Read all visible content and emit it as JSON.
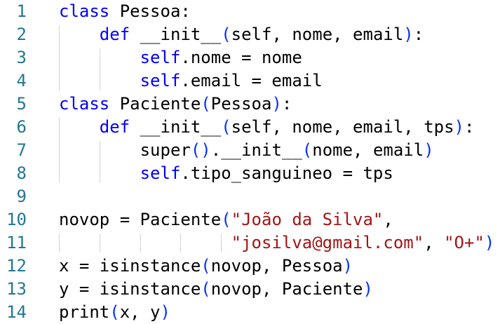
{
  "editor": {
    "lines": [
      {
        "n": "1",
        "t": [
          {
            "c": "kw",
            "v": "class"
          },
          {
            "c": "",
            "v": " Pessoa:"
          }
        ]
      },
      {
        "n": "2",
        "t": [
          {
            "c": "",
            "v": "    "
          },
          {
            "c": "kw",
            "v": "def"
          },
          {
            "c": "",
            "v": " __init__"
          },
          {
            "c": "br",
            "v": "("
          },
          {
            "c": "",
            "v": "self, nome, email"
          },
          {
            "c": "br",
            "v": ")"
          },
          {
            "c": "",
            "v": ":"
          }
        ]
      },
      {
        "n": "3",
        "t": [
          {
            "c": "",
            "v": "        "
          },
          {
            "c": "sf",
            "v": "self"
          },
          {
            "c": "",
            "v": ".nome = nome"
          }
        ]
      },
      {
        "n": "4",
        "t": [
          {
            "c": "",
            "v": "        "
          },
          {
            "c": "sf",
            "v": "self"
          },
          {
            "c": "",
            "v": ".email = email"
          }
        ]
      },
      {
        "n": "5",
        "t": [
          {
            "c": "kw",
            "v": "class"
          },
          {
            "c": "",
            "v": " Paciente"
          },
          {
            "c": "br",
            "v": "("
          },
          {
            "c": "",
            "v": "Pessoa"
          },
          {
            "c": "br",
            "v": ")"
          },
          {
            "c": "",
            "v": ":"
          }
        ]
      },
      {
        "n": "6",
        "t": [
          {
            "c": "",
            "v": "    "
          },
          {
            "c": "kw",
            "v": "def"
          },
          {
            "c": "",
            "v": " __init__"
          },
          {
            "c": "br",
            "v": "("
          },
          {
            "c": "",
            "v": "self, nome, email, tps"
          },
          {
            "c": "br",
            "v": ")"
          },
          {
            "c": "",
            "v": ":"
          }
        ]
      },
      {
        "n": "7",
        "t": [
          {
            "c": "",
            "v": "        super"
          },
          {
            "c": "br",
            "v": "()"
          },
          {
            "c": "",
            "v": ".__init__"
          },
          {
            "c": "br",
            "v": "("
          },
          {
            "c": "",
            "v": "nome, email"
          },
          {
            "c": "br",
            "v": ")"
          }
        ]
      },
      {
        "n": "8",
        "t": [
          {
            "c": "",
            "v": "        "
          },
          {
            "c": "sf",
            "v": "self"
          },
          {
            "c": "",
            "v": ".tipo_sanguineo = tps"
          }
        ]
      },
      {
        "n": "9",
        "t": []
      },
      {
        "n": "10",
        "t": [
          {
            "c": "",
            "v": "novop = Paciente"
          },
          {
            "c": "br",
            "v": "("
          },
          {
            "c": "st",
            "v": "\"João da Silva\""
          },
          {
            "c": "",
            "v": ","
          }
        ]
      },
      {
        "n": "11",
        "t": [
          {
            "c": "",
            "v": "                 "
          },
          {
            "c": "st",
            "v": "\"josilva@gmail.com\""
          },
          {
            "c": "",
            "v": ", "
          },
          {
            "c": "st",
            "v": "\"O+\""
          },
          {
            "c": "br",
            "v": ")"
          }
        ]
      },
      {
        "n": "12",
        "t": [
          {
            "c": "",
            "v": "x = isinstance"
          },
          {
            "c": "br",
            "v": "("
          },
          {
            "c": "",
            "v": "novop, Pessoa"
          },
          {
            "c": "br",
            "v": ")"
          }
        ]
      },
      {
        "n": "13",
        "t": [
          {
            "c": "",
            "v": "y = isinstance"
          },
          {
            "c": "br",
            "v": "("
          },
          {
            "c": "",
            "v": "novop, Paciente"
          },
          {
            "c": "br",
            "v": ")"
          }
        ]
      },
      {
        "n": "14",
        "t": [
          {
            "c": "",
            "v": "print"
          },
          {
            "c": "br",
            "v": "("
          },
          {
            "c": "",
            "v": "x, y"
          },
          {
            "c": "br",
            "v": ")"
          }
        ]
      }
    ]
  },
  "colors": {
    "keyword": "#0000ff",
    "bracket": "#0431fa",
    "string": "#a31515",
    "line_number": "#237893",
    "text": "#000000",
    "indent_guide": "#d3d3d3"
  }
}
